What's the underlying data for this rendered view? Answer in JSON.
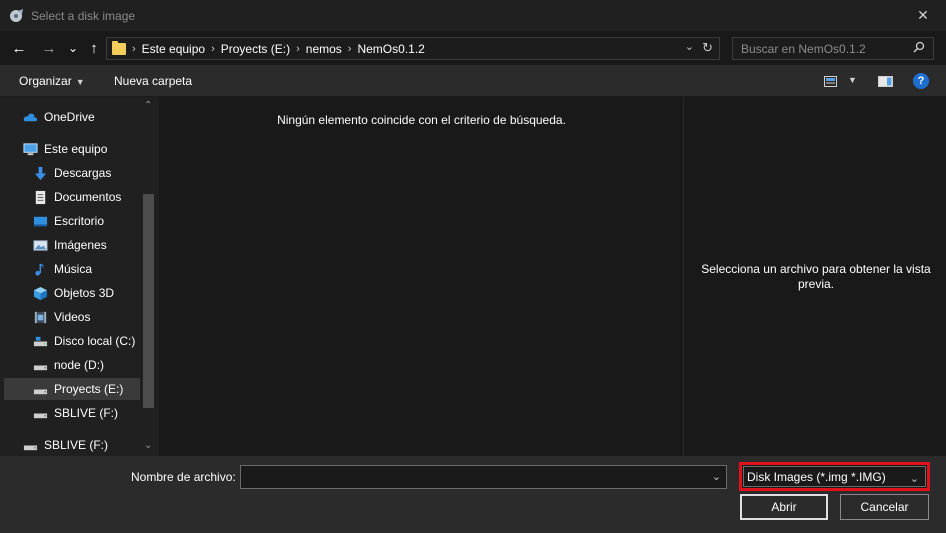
{
  "window": {
    "title": "Select a disk image",
    "close_glyph": "✕"
  },
  "nav": {
    "back": "←",
    "forward": "→",
    "recent": "⌄",
    "up": "↑"
  },
  "breadcrumb": [
    "Este equipo",
    "Proyects (E:)",
    "nemos",
    "NemOs0.1.2"
  ],
  "search": {
    "placeholder": "Buscar en NemOs0.1.2"
  },
  "toolbar": {
    "organize": "Organizar",
    "new_folder": "Nueva carpeta"
  },
  "sidebar": {
    "items": [
      {
        "label": "OneDrive",
        "icon": "cloud-icon"
      },
      {
        "label": "Este equipo",
        "icon": "computer-icon"
      },
      {
        "label": "Descargas",
        "icon": "download-icon"
      },
      {
        "label": "Documentos",
        "icon": "document-icon"
      },
      {
        "label": "Escritorio",
        "icon": "desktop-icon"
      },
      {
        "label": "Imágenes",
        "icon": "pictures-icon"
      },
      {
        "label": "Música",
        "icon": "music-icon"
      },
      {
        "label": "Objetos 3D",
        "icon": "cube-icon"
      },
      {
        "label": "Videos",
        "icon": "video-icon"
      },
      {
        "label": "Disco local (C:)",
        "icon": "drive-c-icon"
      },
      {
        "label": "node (D:)",
        "icon": "drive-icon"
      },
      {
        "label": "Proyects (E:)",
        "icon": "drive-icon",
        "selected": true
      },
      {
        "label": "SBLIVE (F:)",
        "icon": "drive-icon"
      },
      {
        "label": "SBLIVE (F:)",
        "icon": "drive-icon"
      }
    ]
  },
  "main": {
    "empty_message": "Ningún elemento coincide con el criterio de búsqueda."
  },
  "preview": {
    "message": "Selecciona un archivo para obtener la vista previa."
  },
  "bottom": {
    "filename_label": "Nombre de archivo:",
    "filename_value": "",
    "filetype": "Disk Images (*.img *.IMG)",
    "open_button": "Abrir",
    "cancel_button": "Cancelar"
  },
  "colors": {
    "highlight_border": "#e0111a",
    "help": "#1e6fd0",
    "folder": "#f4ce5c"
  }
}
